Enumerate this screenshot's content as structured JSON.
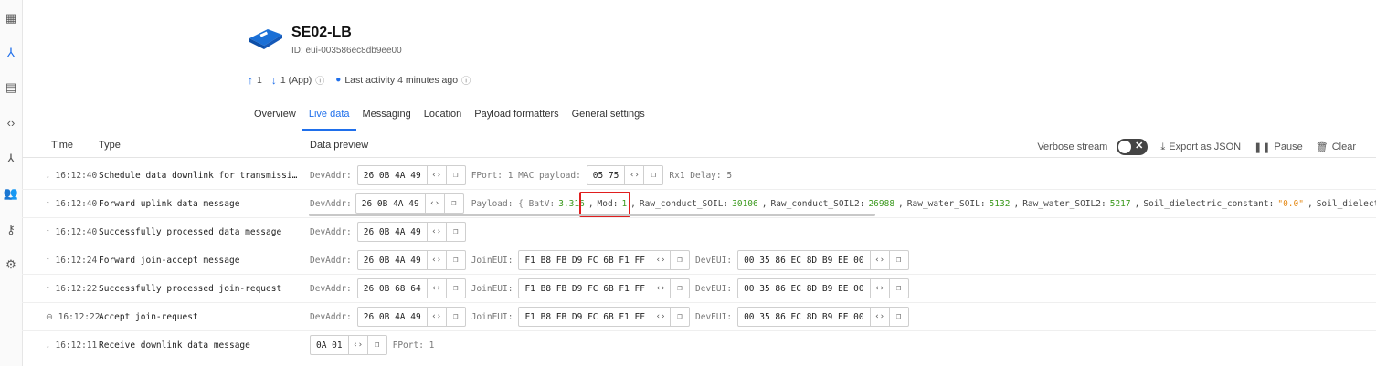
{
  "device": {
    "name": "SE02-LB",
    "id": "ID: eui-003586ec8db9ee00",
    "uplink_count": "1",
    "downlink_count": "1 (App)",
    "last_activity": "Last activity 4 minutes ago"
  },
  "tabs": [
    "Overview",
    "Live data",
    "Messaging",
    "Location",
    "Payload formatters",
    "General settings"
  ],
  "table": {
    "col_time": "Time",
    "col_type": "Type",
    "col_preview": "Data preview"
  },
  "tools": {
    "verbose": "Verbose stream",
    "export": "Export as JSON",
    "pause": "Pause",
    "clear": "Clear"
  },
  "rows": [
    {
      "time": "16:12:40",
      "dir": "↓",
      "type": "Schedule data downlink for transmissi…",
      "devaddr_label": "DevAddr:",
      "devaddr": "26 0B 4A 49",
      "extra": "FPort: 1   MAC payload:",
      "mac": "05 75",
      "tail": "Rx1 Delay: 5"
    },
    {
      "time": "16:12:40",
      "dir": "↑",
      "type": "Forward uplink data message",
      "devaddr_label": "DevAddr:",
      "devaddr": "26 0B 4A 49",
      "payload_label": "Payload: { BatV:",
      "batv": "3.316",
      "mod_key": "Mod:",
      "mod": "1",
      "k1": "Raw_conduct_SOIL:",
      "v1": "30106",
      "k2": "Raw_conduct_SOIL2:",
      "v2": "26988",
      "k3": "Raw_water_SOIL:",
      "v3": "5132",
      "k4": "Raw_water_SOIL2:",
      "v4": "5217",
      "k5": "Soil_dielectric_constant:",
      "v5": "\"0.0\"",
      "k6": "Soil_dielect:"
    },
    {
      "time": "16:12:40",
      "dir": "↑",
      "type": "Successfully processed data message",
      "devaddr_label": "DevAddr:",
      "devaddr": "26 0B 4A 49"
    },
    {
      "time": "16:12:24",
      "dir": "↑",
      "type": "Forward join-accept message",
      "devaddr_label": "DevAddr:",
      "devaddr": "26 0B 4A 49",
      "joineui_label": "JoinEUI:",
      "joineui": "F1 B8 FB D9 FC 6B F1 FF",
      "deveui_label": "DevEUI:",
      "deveui": "00 35 86 EC 8D B9 EE 00"
    },
    {
      "time": "16:12:22",
      "dir": "↑",
      "type": "Successfully processed join-request",
      "devaddr_label": "DevAddr:",
      "devaddr": "26 0B 68 64",
      "joineui_label": "JoinEUI:",
      "joineui": "F1 B8 FB D9 FC 6B F1 FF",
      "deveui_label": "DevEUI:",
      "deveui": "00 35 86 EC 8D B9 EE 00"
    },
    {
      "time": "16:12:22",
      "dir": "⊖",
      "type": "Accept join-request",
      "devaddr_label": "DevAddr:",
      "devaddr": "26 0B 4A 49",
      "joineui_label": "JoinEUI:",
      "joineui": "F1 B8 FB D9 FC 6B F1 FF",
      "deveui_label": "DevEUI:",
      "deveui": "00 35 86 EC 8D B9 EE 00"
    },
    {
      "time": "16:12:11",
      "dir": "↓",
      "type": "Receive downlink data message",
      "payload": "0A 01",
      "tail": "FPort: 1"
    }
  ]
}
